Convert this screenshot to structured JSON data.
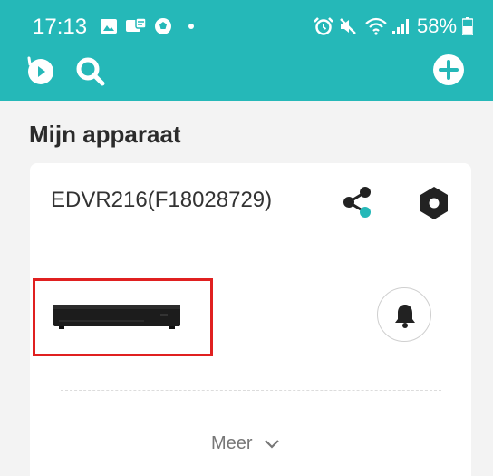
{
  "status_bar": {
    "time": "17:13",
    "battery": "58%",
    "icons": [
      "gallery-icon",
      "message-icon",
      "soccer-icon",
      "notification-dot",
      "alarm-icon",
      "mute-icon",
      "wifi-icon",
      "signal-icon",
      "battery-icon"
    ]
  },
  "toolbar": {
    "left_icons": [
      "playback-icon",
      "search-icon"
    ],
    "right_icons": [
      "add-icon"
    ]
  },
  "section": {
    "title": "Mijn apparaat"
  },
  "device_card": {
    "name": "EDVR216(F18028729)",
    "actions": [
      "share-icon",
      "settings-icon",
      "bell-icon"
    ],
    "more_label": "Meer"
  },
  "colors": {
    "header": "#25b8b8",
    "background": "#f3f3f3",
    "card": "#ffffff",
    "highlight_border": "#e02020",
    "text_dark": "#2b2b2b"
  }
}
